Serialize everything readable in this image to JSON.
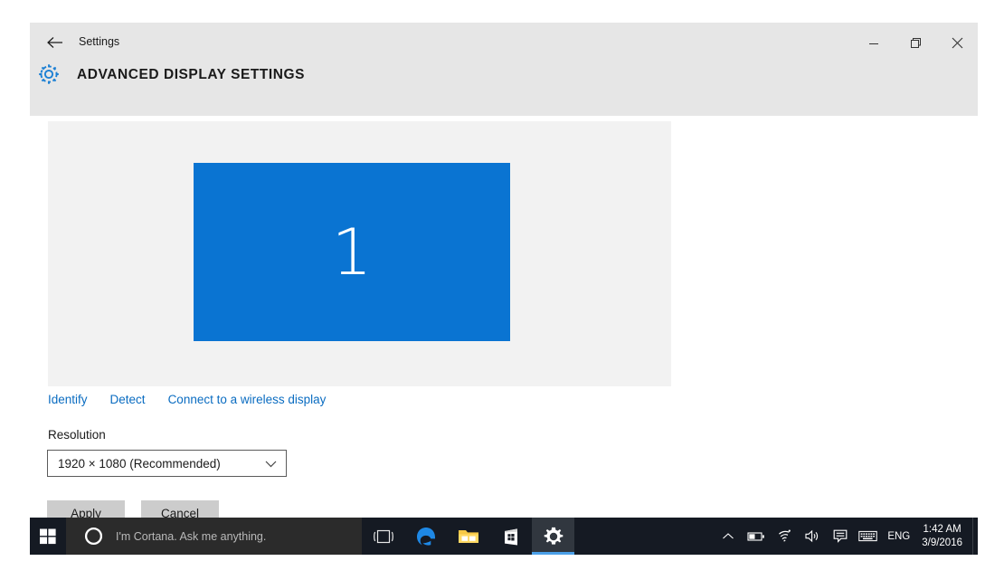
{
  "window": {
    "app_title": "Settings",
    "page_title": "ADVANCED DISPLAY SETTINGS",
    "back_icon": "back-arrow-icon",
    "settings_icon": "gear-icon",
    "controls": {
      "minimize": "minimize-icon",
      "restore": "restore-icon",
      "close": "close-icon"
    }
  },
  "display_preview": {
    "monitor_number": "1",
    "monitor_color": "#0a74d2",
    "panel_color": "#f2f2f2"
  },
  "links": [
    {
      "label": "Identify",
      "name": "identify-link"
    },
    {
      "label": "Detect",
      "name": "detect-link"
    },
    {
      "label": "Connect to a wireless display",
      "name": "connect-wireless-display-link"
    }
  ],
  "resolution": {
    "label": "Resolution",
    "selected": "1920 × 1080 (Recommended)",
    "chevron": "chevron-down-icon"
  },
  "buttons": {
    "apply": "Apply",
    "cancel": "Cancel"
  },
  "taskbar": {
    "start_icon": "windows-logo-icon",
    "cortana": {
      "icon": "cortana-circle-icon",
      "placeholder": "I'm Cortana. Ask me anything."
    },
    "apps": [
      {
        "name": "task-view-icon",
        "label": "Task View"
      },
      {
        "name": "edge-icon",
        "label": "Microsoft Edge"
      },
      {
        "name": "file-explorer-icon",
        "label": "File Explorer"
      },
      {
        "name": "store-icon",
        "label": "Store"
      },
      {
        "name": "settings-icon",
        "label": "Settings"
      }
    ],
    "tray": {
      "show_hidden": "chevron-up-icon",
      "battery": "battery-icon",
      "network": "wifi-icon",
      "volume": "speaker-icon",
      "action_center": "action-center-icon",
      "keyboard": "keyboard-icon",
      "language": "ENG",
      "time": "1:42 AM",
      "date": "3/9/2016"
    }
  },
  "colors": {
    "accent": "#0a74d2",
    "link": "#0a6cc1",
    "header_bg": "#e6e6e6",
    "taskbar_bg": "#151a23"
  }
}
